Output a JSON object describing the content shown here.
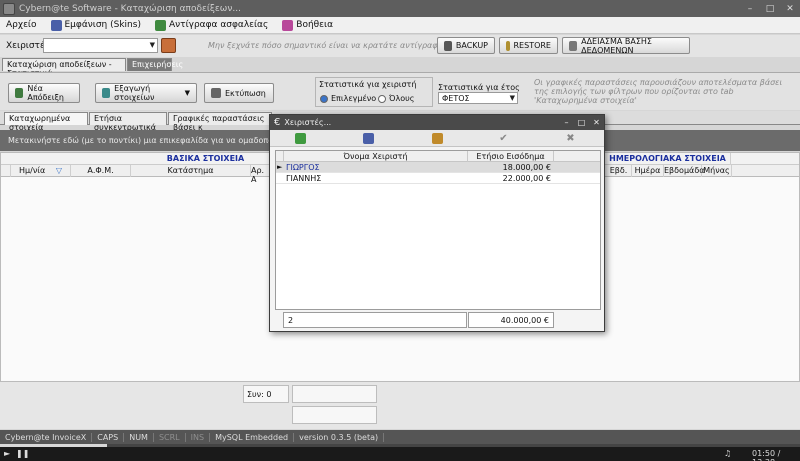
{
  "window": {
    "title": "Cybern@te Software - Καταχώριση αποδείξεων..."
  },
  "menu": [
    {
      "label": "Αρχείο"
    },
    {
      "label": "Εμφάνιση (Skins)"
    },
    {
      "label": "Αντίγραφα ασφαλείας"
    },
    {
      "label": "Βοήθεια"
    }
  ],
  "toolbar": {
    "users_label": "Χειριστές",
    "users_value": "",
    "hint": "Μην ξεχνάτε πόσο σημαντικό είναι να κρατάτε αντίγραφα ασφαλείας",
    "backup_label": "BACKUP",
    "restore_label": "RESTORE",
    "clear_label": "ΑΔΕΙΑΣΜΑ ΒΑΣΗΣ ΔΕΔΟΜΕΝΩΝ"
  },
  "tabs_top": [
    {
      "label": "Καταχώριση αποδείξεων - Στατιστικά"
    },
    {
      "label": "Επιχειρήσεις"
    }
  ],
  "stats": {
    "new_receipt": "Νέα Απόδειξη",
    "export": "Εξαγωγή στοιχείων",
    "print": "Εκτύπωση",
    "user_stats_title": "Στατιστικά για χειριστή",
    "radio_selected": "Επιλεγμένο",
    "radio_all": "Όλους",
    "year_stats_title": "Στατιστικά για έτος",
    "year_value": "ΦΕΤΟΣ",
    "hint_line1": "Οι γραφικές παραστάσεις παρουσιάζουν αποτελέσματα βάσει",
    "hint_line2": "της επιλογής των φίλτρων που ορίζονται στο tab",
    "hint_line3": "'Καταχωρημένα στοιχεία'"
  },
  "tabs_inner": [
    {
      "label": "Καταχωρημένα στοιχεία"
    },
    {
      "label": "Ετήσια συγκεντρωτικά"
    },
    {
      "label": "Γραφικές παραστάσεις βάσει κ"
    }
  ],
  "group_hint": "Μετακινήστε εδώ (με το ποντίκι) μια επικεφαλίδα για να ομαδοποιήσετε με βάση",
  "grid": {
    "band_basic": "ΒΑΣΙΚΑ ΣΤΟΙΧΕΙΑ",
    "band_calendar": "ΗΜΕΡΟΛΟΓΙΑΚΑ ΣΤΟΙΧΕΙΑ",
    "col_date": "Ημ/νία",
    "col_afm": "Α.Φ.Μ.",
    "col_store": "Κατάστημα",
    "col_ar": "Αρ. Α",
    "col_week": "Εβδ.",
    "col_day": "Ημέρα",
    "col_weekday": "Εβδομάδα",
    "col_month": "Μήνας"
  },
  "footer": {
    "sum_label": "Συν: 0"
  },
  "dialog": {
    "title": "Χειριστές...",
    "col_name": "Όνομα Χειριστή",
    "col_income": "Ετήσιο Εισόδημα",
    "rows": [
      {
        "name": "ΓΙΩΡΓΟΣ",
        "income": "18.000,00 €"
      },
      {
        "name": "ΓΙΑΝΝΗΣ",
        "income": "22.000,00 €"
      }
    ],
    "count": "2",
    "total": "40.000,00 €"
  },
  "status": {
    "app": "Cybern@te InvoiceX",
    "caps": "CAPS",
    "num": "NUM",
    "scrl": "SCRL",
    "ins": "INS",
    "db": "MySQL Embedded",
    "version": "version 0.3.5 (beta)"
  },
  "player": {
    "time": "01:50 / 13:38",
    "progress": 0.134
  },
  "colors": {
    "titlebar": "#5e5e5e",
    "accent_blue": "#1b2f9e",
    "selected_radio": "#3a74c9"
  }
}
